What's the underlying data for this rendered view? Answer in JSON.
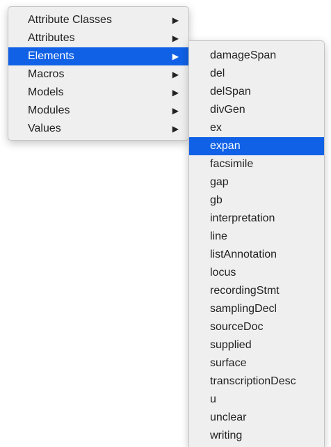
{
  "main_menu": {
    "items": [
      {
        "label": "Attribute Classes",
        "arrow": "▶"
      },
      {
        "label": "Attributes",
        "arrow": "▶"
      },
      {
        "label": "Elements",
        "arrow": "▶",
        "selected": true
      },
      {
        "label": "Macros",
        "arrow": "▶"
      },
      {
        "label": "Models",
        "arrow": "▶"
      },
      {
        "label": "Modules",
        "arrow": "▶"
      },
      {
        "label": "Values",
        "arrow": "▶"
      }
    ]
  },
  "sub_menu": {
    "items": [
      {
        "label": "damageSpan"
      },
      {
        "label": "del"
      },
      {
        "label": "delSpan"
      },
      {
        "label": "divGen"
      },
      {
        "label": "ex"
      },
      {
        "label": "expan",
        "selected": true
      },
      {
        "label": "facsimile"
      },
      {
        "label": "gap"
      },
      {
        "label": "gb"
      },
      {
        "label": "interpretation"
      },
      {
        "label": "line"
      },
      {
        "label": "listAnnotation"
      },
      {
        "label": "locus"
      },
      {
        "label": "recordingStmt"
      },
      {
        "label": "samplingDecl"
      },
      {
        "label": "sourceDoc"
      },
      {
        "label": "supplied"
      },
      {
        "label": "surface"
      },
      {
        "label": "transcriptionDesc"
      },
      {
        "label": "u"
      },
      {
        "label": "unclear"
      },
      {
        "label": "writing"
      }
    ]
  },
  "colors": {
    "menu_bg": "#efefef",
    "selection": "#1061e6",
    "text": "#222222"
  }
}
